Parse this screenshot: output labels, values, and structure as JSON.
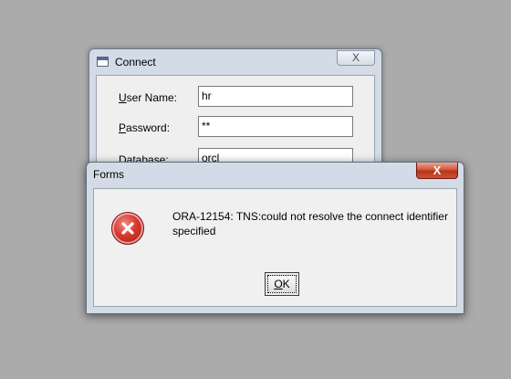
{
  "connect_dialog": {
    "title": "Connect",
    "close_glyph": "X",
    "user_name": {
      "label_first": "U",
      "label_rest": "ser Name:",
      "value": "hr"
    },
    "password": {
      "label_first": "P",
      "label_rest": "assword:",
      "value": "**"
    },
    "database": {
      "label_first": "D",
      "label_rest": "atabase:",
      "value": "orcl"
    }
  },
  "forms_dialog": {
    "title": "Forms",
    "close_glyph": "X",
    "icon": "error-icon",
    "message": "ORA-12154: TNS:could not resolve the connect identifier specified",
    "ok_button": {
      "label_first": "O",
      "label_rest": "K"
    }
  },
  "colors": {
    "desktop": "#ababab",
    "error_icon": "#d8362d",
    "close_button_active": "#c9553b"
  }
}
